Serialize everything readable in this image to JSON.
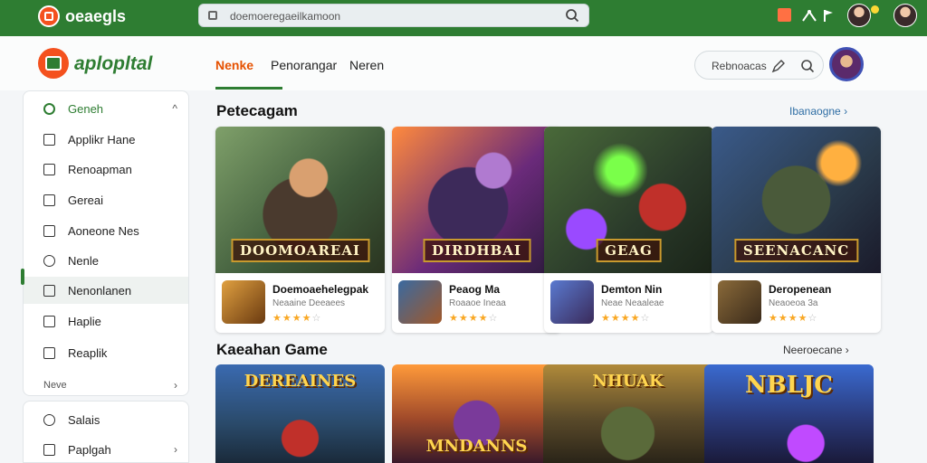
{
  "chrome": {
    "title": "oeaegls",
    "url": "doemoeregaeilkamoon"
  },
  "header": {
    "brand": "aplopltal",
    "tabs": [
      "Nenke",
      "Penorangar",
      "Neren"
    ],
    "search_label": "Rebnoacas"
  },
  "sidebar": {
    "items": [
      {
        "label": "Geneh",
        "icon": "circle-icon"
      },
      {
        "label": "Applikr Hane",
        "icon": "app-icon"
      },
      {
        "label": "Renoapman",
        "icon": "store-icon"
      },
      {
        "label": "Gereai",
        "icon": "game-icon"
      },
      {
        "label": "Aoneone Nes",
        "icon": "edit-icon"
      },
      {
        "label": "Nenle",
        "icon": "circle-outline-icon"
      },
      {
        "label": "Nenonlanen",
        "icon": "grid-icon"
      },
      {
        "label": "Haplie",
        "icon": "book-icon"
      },
      {
        "label": "Reaplik",
        "icon": "tag-icon"
      },
      {
        "label": "Neve",
        "icon": ""
      }
    ],
    "items2": [
      {
        "label": "Salais",
        "icon": "settings-icon"
      },
      {
        "label": "Paplgah",
        "icon": "bag-icon"
      }
    ]
  },
  "section1": {
    "title": "Petecagam",
    "link": "Ibanaogne"
  },
  "cards": [
    {
      "banner": "DOOMOAREAI",
      "name": "Doemoaehelegpak",
      "sub": "Neaaine Deeaees",
      "rating": 4
    },
    {
      "banner": "DIRDHBAI",
      "name": "Peaog Ma",
      "sub": "Roaaoe Ineaa",
      "rating": 4
    },
    {
      "banner": "GEAG",
      "name": "Demton Nin",
      "sub": "Neae Neaaleae",
      "rating": 4
    },
    {
      "banner": "SEENACANC",
      "name": "Deropenean",
      "sub": "Neaoeoa 3a",
      "rating": 4
    }
  ],
  "section2": {
    "title": "Kaeahan Game",
    "link": "Neeroecane"
  },
  "cards2": [
    {
      "banner": "DEREAINES"
    },
    {
      "banner": "MNDANNS"
    },
    {
      "banner": "NHUAK"
    },
    {
      "banner": "NBLJC"
    }
  ],
  "colors": {
    "brand_green": "#2e7d32",
    "accent_orange": "#e65100",
    "star": "#f9a825"
  }
}
